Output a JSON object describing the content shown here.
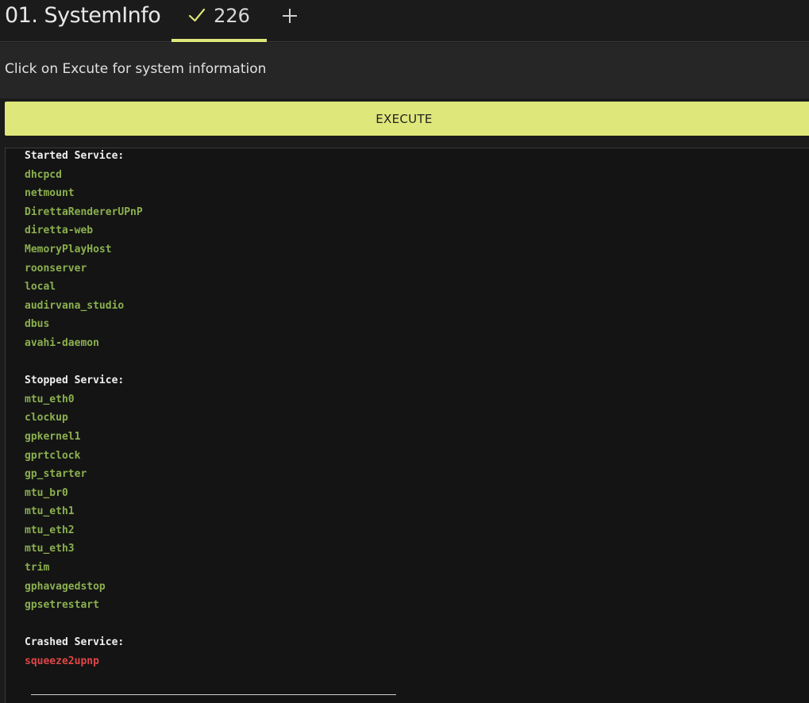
{
  "header": {
    "title": "01. SystemInfo",
    "tab_count": "226",
    "add_tab_label": "+"
  },
  "panel": {
    "hint": "Click on Excute for system information"
  },
  "execute": {
    "label": "EXECUTE"
  },
  "output": {
    "started": {
      "heading": "Started Service:",
      "items": [
        "dhcpcd",
        "netmount",
        "DirettaRendererUPnP",
        "diretta-web",
        "MemoryPlayHost",
        "roonserver",
        "local",
        "audirvana_studio",
        "dbus",
        "avahi-daemon"
      ]
    },
    "stopped": {
      "heading": "Stopped Service:",
      "items": [
        "mtu_eth0",
        "clockup",
        "gpkernel1",
        "gprtclock",
        "gp_starter",
        "mtu_br0",
        "mtu_eth1",
        "mtu_eth2",
        "mtu_eth3",
        "trim",
        "gphavagedstop",
        "gpsetrestart"
      ]
    },
    "crashed": {
      "heading": "Crashed Service:",
      "items": [
        "squeeze2upnp"
      ]
    }
  },
  "colors": {
    "accent": "#dde77a",
    "ok": "#8bb04f",
    "error": "#e04646",
    "background": "#1b1b1b"
  },
  "icons": {
    "tab_status": "check-icon",
    "add_tab": "plus-icon"
  }
}
